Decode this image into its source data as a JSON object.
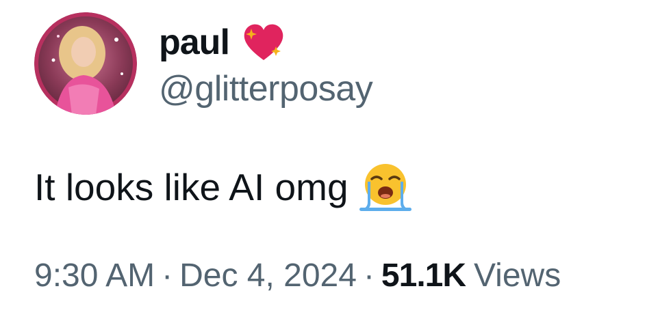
{
  "author": {
    "display_name": "paul",
    "handle": "@glitterposay",
    "name_emoji": "sparkling-heart-icon"
  },
  "tweet": {
    "text": "It looks like AI omg",
    "trailing_emoji": "loudly-crying-face-icon"
  },
  "meta": {
    "time": "9:30 AM",
    "separator": "·",
    "date": "Dec 4, 2024",
    "views_count": "51.1K",
    "views_label": "Views"
  },
  "colors": {
    "primary_text": "#0f1419",
    "secondary_text": "#536471",
    "heart": "#e0245e",
    "sparkle": "#f5b21b",
    "emoji_face": "#f9c22e",
    "tears": "#5dadec"
  }
}
